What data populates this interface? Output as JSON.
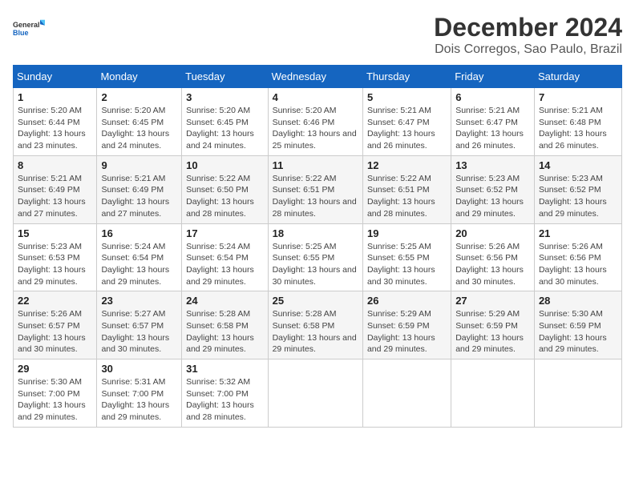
{
  "logo": {
    "line1": "General",
    "line2": "Blue"
  },
  "title": "December 2024",
  "location": "Dois Corregos, Sao Paulo, Brazil",
  "weekdays": [
    "Sunday",
    "Monday",
    "Tuesday",
    "Wednesday",
    "Thursday",
    "Friday",
    "Saturday"
  ],
  "weeks": [
    [
      {
        "day": "1",
        "sunrise": "5:20 AM",
        "sunset": "6:44 PM",
        "daylight": "13 hours and 23 minutes."
      },
      {
        "day": "2",
        "sunrise": "5:20 AM",
        "sunset": "6:45 PM",
        "daylight": "13 hours and 24 minutes."
      },
      {
        "day": "3",
        "sunrise": "5:20 AM",
        "sunset": "6:45 PM",
        "daylight": "13 hours and 24 minutes."
      },
      {
        "day": "4",
        "sunrise": "5:20 AM",
        "sunset": "6:46 PM",
        "daylight": "13 hours and 25 minutes."
      },
      {
        "day": "5",
        "sunrise": "5:21 AM",
        "sunset": "6:47 PM",
        "daylight": "13 hours and 26 minutes."
      },
      {
        "day": "6",
        "sunrise": "5:21 AM",
        "sunset": "6:47 PM",
        "daylight": "13 hours and 26 minutes."
      },
      {
        "day": "7",
        "sunrise": "5:21 AM",
        "sunset": "6:48 PM",
        "daylight": "13 hours and 26 minutes."
      }
    ],
    [
      {
        "day": "8",
        "sunrise": "5:21 AM",
        "sunset": "6:49 PM",
        "daylight": "13 hours and 27 minutes."
      },
      {
        "day": "9",
        "sunrise": "5:21 AM",
        "sunset": "6:49 PM",
        "daylight": "13 hours and 27 minutes."
      },
      {
        "day": "10",
        "sunrise": "5:22 AM",
        "sunset": "6:50 PM",
        "daylight": "13 hours and 28 minutes."
      },
      {
        "day": "11",
        "sunrise": "5:22 AM",
        "sunset": "6:51 PM",
        "daylight": "13 hours and 28 minutes."
      },
      {
        "day": "12",
        "sunrise": "5:22 AM",
        "sunset": "6:51 PM",
        "daylight": "13 hours and 28 minutes."
      },
      {
        "day": "13",
        "sunrise": "5:23 AM",
        "sunset": "6:52 PM",
        "daylight": "13 hours and 29 minutes."
      },
      {
        "day": "14",
        "sunrise": "5:23 AM",
        "sunset": "6:52 PM",
        "daylight": "13 hours and 29 minutes."
      }
    ],
    [
      {
        "day": "15",
        "sunrise": "5:23 AM",
        "sunset": "6:53 PM",
        "daylight": "13 hours and 29 minutes."
      },
      {
        "day": "16",
        "sunrise": "5:24 AM",
        "sunset": "6:54 PM",
        "daylight": "13 hours and 29 minutes."
      },
      {
        "day": "17",
        "sunrise": "5:24 AM",
        "sunset": "6:54 PM",
        "daylight": "13 hours and 29 minutes."
      },
      {
        "day": "18",
        "sunrise": "5:25 AM",
        "sunset": "6:55 PM",
        "daylight": "13 hours and 30 minutes."
      },
      {
        "day": "19",
        "sunrise": "5:25 AM",
        "sunset": "6:55 PM",
        "daylight": "13 hours and 30 minutes."
      },
      {
        "day": "20",
        "sunrise": "5:26 AM",
        "sunset": "6:56 PM",
        "daylight": "13 hours and 30 minutes."
      },
      {
        "day": "21",
        "sunrise": "5:26 AM",
        "sunset": "6:56 PM",
        "daylight": "13 hours and 30 minutes."
      }
    ],
    [
      {
        "day": "22",
        "sunrise": "5:26 AM",
        "sunset": "6:57 PM",
        "daylight": "13 hours and 30 minutes."
      },
      {
        "day": "23",
        "sunrise": "5:27 AM",
        "sunset": "6:57 PM",
        "daylight": "13 hours and 30 minutes."
      },
      {
        "day": "24",
        "sunrise": "5:28 AM",
        "sunset": "6:58 PM",
        "daylight": "13 hours and 29 minutes."
      },
      {
        "day": "25",
        "sunrise": "5:28 AM",
        "sunset": "6:58 PM",
        "daylight": "13 hours and 29 minutes."
      },
      {
        "day": "26",
        "sunrise": "5:29 AM",
        "sunset": "6:59 PM",
        "daylight": "13 hours and 29 minutes."
      },
      {
        "day": "27",
        "sunrise": "5:29 AM",
        "sunset": "6:59 PM",
        "daylight": "13 hours and 29 minutes."
      },
      {
        "day": "28",
        "sunrise": "5:30 AM",
        "sunset": "6:59 PM",
        "daylight": "13 hours and 29 minutes."
      }
    ],
    [
      {
        "day": "29",
        "sunrise": "5:30 AM",
        "sunset": "7:00 PM",
        "daylight": "13 hours and 29 minutes."
      },
      {
        "day": "30",
        "sunrise": "5:31 AM",
        "sunset": "7:00 PM",
        "daylight": "13 hours and 29 minutes."
      },
      {
        "day": "31",
        "sunrise": "5:32 AM",
        "sunset": "7:00 PM",
        "daylight": "13 hours and 28 minutes."
      },
      null,
      null,
      null,
      null
    ]
  ],
  "labels": {
    "sunrise": "Sunrise:",
    "sunset": "Sunset:",
    "daylight": "Daylight:"
  }
}
